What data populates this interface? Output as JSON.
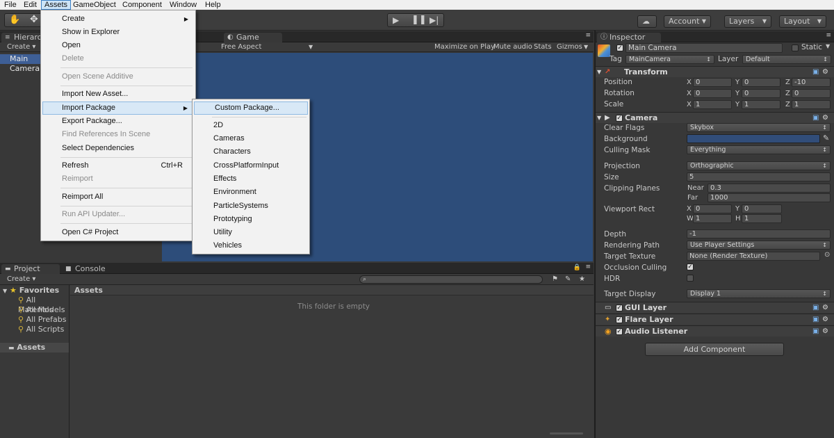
{
  "menubar": {
    "items": [
      "File",
      "Edit",
      "Assets",
      "GameObject",
      "Component",
      "Window",
      "Help"
    ]
  },
  "toolbar": {
    "account": "Account",
    "layers": "Layers",
    "layout": "Layout"
  },
  "hierarchy": {
    "tab": "Hierarchy",
    "create": "Create",
    "create_arrow": "▾",
    "items": [
      "Main Camera"
    ]
  },
  "game": {
    "tab": "Game",
    "aspect": "Free Aspect",
    "maximize": "Maximize on Play",
    "mute": "Mute audio",
    "stats": "Stats",
    "gizmos": "Gizmos"
  },
  "assets_menu": {
    "items": [
      {
        "label": "Create",
        "disabled": false,
        "submenu": true
      },
      {
        "label": "Show in Explorer",
        "disabled": false
      },
      {
        "label": "Open",
        "disabled": false
      },
      {
        "label": "Delete",
        "disabled": true
      },
      {
        "label": "Open Scene Additive",
        "disabled": true
      },
      {
        "label": "Import New Asset...",
        "disabled": false
      },
      {
        "label": "Import Package",
        "disabled": false,
        "submenu": true,
        "highlighted": true
      },
      {
        "label": "Export Package...",
        "disabled": false
      },
      {
        "label": "Find References In Scene",
        "disabled": true
      },
      {
        "label": "Select Dependencies",
        "disabled": false
      },
      {
        "label": "Refresh",
        "disabled": false,
        "shortcut": "Ctrl+R"
      },
      {
        "label": "Reimport",
        "disabled": true
      },
      {
        "label": "Reimport All",
        "disabled": false
      },
      {
        "label": "Run API Updater...",
        "disabled": true
      },
      {
        "label": "Open C# Project",
        "disabled": false
      }
    ]
  },
  "import_submenu": {
    "items": [
      "Custom Package...",
      "2D",
      "Cameras",
      "Characters",
      "CrossPlatformInput",
      "Effects",
      "Environment",
      "ParticleSystems",
      "Prototyping",
      "Utility",
      "Vehicles"
    ]
  },
  "inspector": {
    "tab": "Inspector",
    "object_name": "Main Camera",
    "static_label": "Static",
    "tag_label": "Tag",
    "tag": "MainCamera",
    "layer_label": "Layer",
    "layer": "Default",
    "transform": {
      "title": "Transform",
      "position_label": "Position",
      "rotation_label": "Rotation",
      "scale_label": "Scale",
      "position": {
        "x": "0",
        "y": "0",
        "z": "-10"
      },
      "rotation": {
        "x": "0",
        "y": "0",
        "z": "0"
      },
      "scale": {
        "x": "1",
        "y": "1",
        "z": "1"
      }
    },
    "camera": {
      "title": "Camera",
      "clear_flags_label": "Clear Flags",
      "clear_flags": "Skybox",
      "background_label": "Background",
      "background_color": "#314d79",
      "culling_mask_label": "Culling Mask",
      "culling_mask": "Everything",
      "projection_label": "Projection",
      "projection": "Orthographic",
      "size_label": "Size",
      "size": "5",
      "clipping_label": "Clipping Planes",
      "near_label": "Near",
      "near": "0.3",
      "far_label": "Far",
      "far": "1000",
      "viewport_label": "Viewport Rect",
      "vx": "0",
      "vy": "0",
      "vw": "1",
      "vh": "1",
      "depth_label": "Depth",
      "depth": "-1",
      "rendering_path_label": "Rendering Path",
      "rendering_path": "Use Player Settings",
      "target_texture_label": "Target Texture",
      "target_texture": "None (Render Texture)",
      "occlusion_label": "Occlusion Culling",
      "hdr_label": "HDR",
      "target_display_label": "Target Display",
      "target_display": "Display 1"
    },
    "components": [
      "GUI Layer",
      "Flare Layer",
      "Audio Listener"
    ],
    "add_component": "Add Component"
  },
  "project": {
    "tab": "Project",
    "console_tab": "Console",
    "create": "Create",
    "create_arrow": "▾",
    "favorites": "Favorites",
    "favorite_items": [
      "All Materials",
      "All Models",
      "All Prefabs",
      "All Scripts"
    ],
    "assets_root": "Assets",
    "assets_header": "Assets",
    "empty_msg": "This folder is empty"
  },
  "axis_labels": {
    "x": "X",
    "y": "Y",
    "z": "Z",
    "w": "W",
    "h": "H"
  }
}
